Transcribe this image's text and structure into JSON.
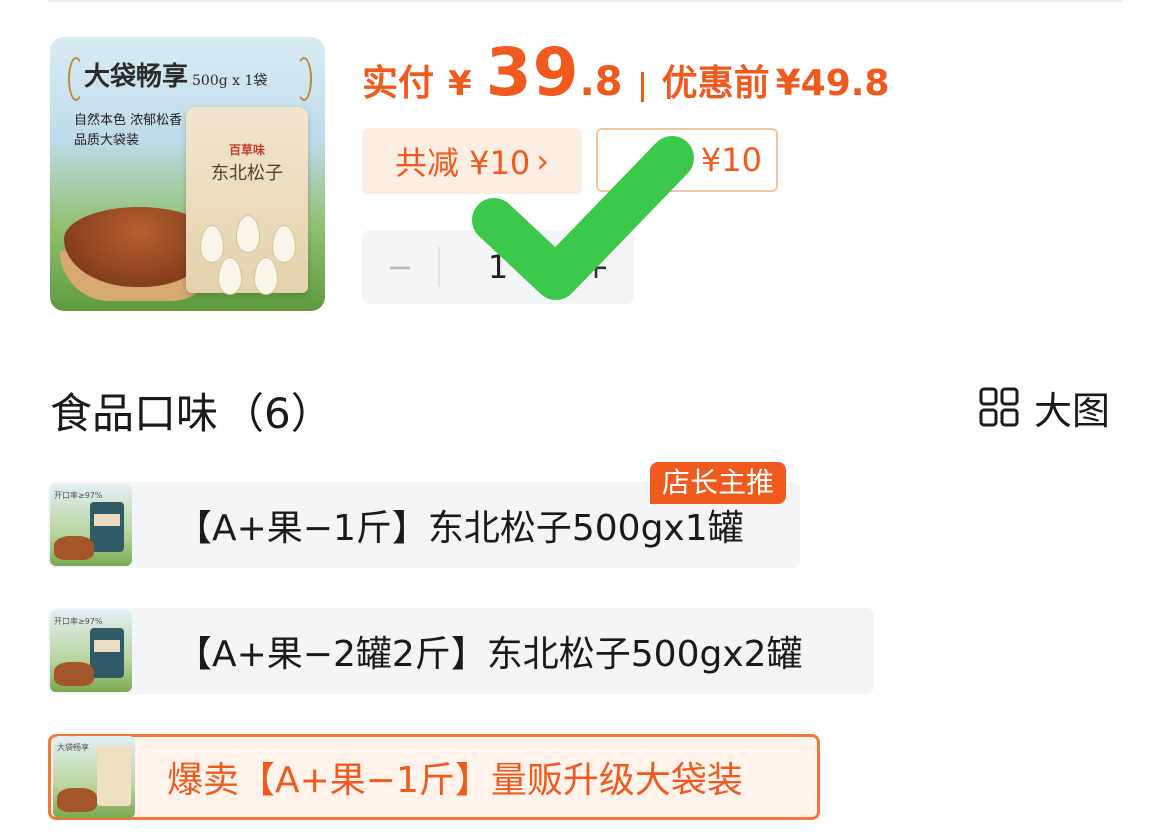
{
  "product": {
    "image": {
      "title": "大袋畅享",
      "spec": "500g x 1袋",
      "line1": "自然本色 浓郁松香",
      "line2": "品质大袋装",
      "bag_brand": "百草味",
      "bag_name": "东北松子"
    },
    "price": {
      "label": "实付",
      "currency": "¥",
      "integer": "39",
      "decimal": ".8",
      "original_label": "优惠前",
      "original_value": "¥49.8"
    },
    "discount_chip": {
      "text": "共减 ¥10",
      "chevron": "›"
    },
    "coupon_chip": {
      "text": "¥10"
    },
    "quantity": {
      "minus": "−",
      "value": "1",
      "plus": "+"
    }
  },
  "section": {
    "title": "食品口味",
    "count": "（6）",
    "view_toggle_label": "大图",
    "view_toggle_icon": "grid-icon"
  },
  "options": [
    {
      "label": "【A+果−1斤】东北松子500gx1罐",
      "badge": "店长主推",
      "thumb_caption": "开口率≥97%"
    },
    {
      "label": "【A+果−2罐2斤】东北松子500gx2罐",
      "thumb_caption": "开口率≥97%"
    },
    {
      "label": "爆卖【A+果−1斤】量贩升级大袋装",
      "thumb_caption": "大袋畅享",
      "selected": true
    }
  ],
  "colors": {
    "accent": "#f05a1e",
    "chip_bg": "#fdeee4",
    "checkmark": "#3cc84a",
    "option_bg": "#f4f5f7"
  }
}
